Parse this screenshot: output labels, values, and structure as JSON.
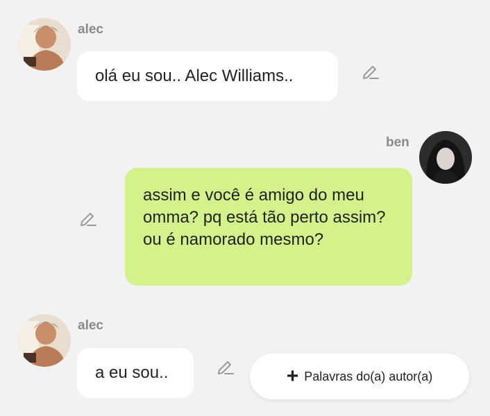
{
  "colors": {
    "background": "#f2f2f2",
    "bubble_incoming": "#ffffff",
    "bubble_outgoing": "#d4f28c",
    "sender_name": "#8a8a8a",
    "text": "#222222"
  },
  "messages": [
    {
      "sender": "alec",
      "text": "olá eu sou.. Alec Williams..",
      "side": "left"
    },
    {
      "sender": "ben",
      "text": "assim e você é amigo do meu omma? pq está tão perto assim? ou é namorado mesmo?",
      "side": "right"
    },
    {
      "sender": "alec",
      "text": "a eu sou..",
      "side": "left"
    }
  ],
  "icons": {
    "edit": "pencil-edit-icon",
    "add": "plus-icon"
  },
  "author_words_button": {
    "plus": "+",
    "label": "Palavras do(a) autor(a)"
  }
}
